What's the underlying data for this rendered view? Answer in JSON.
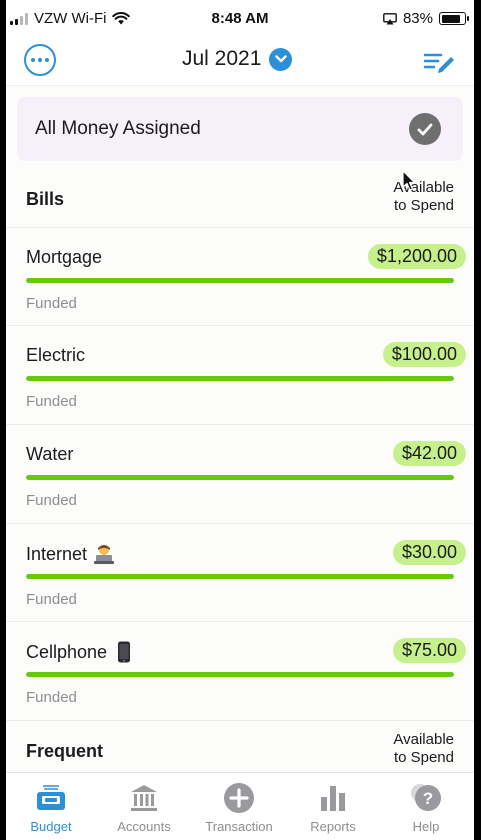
{
  "status_bar": {
    "carrier": "VZW Wi-Fi",
    "time": "8:48 AM",
    "battery_percent": "83%",
    "battery_level": 0.83
  },
  "header": {
    "month": "Jul 2021",
    "more_icon": "ellipsis-circle-icon",
    "month_icon": "chevron-down-circle-icon",
    "edit_icon": "edit-list-icon"
  },
  "assigned_banner": {
    "label": "All Money Assigned",
    "icon": "check-circle-icon"
  },
  "groups": [
    {
      "title": "Bills",
      "available_label": [
        "Available",
        "to Spend"
      ]
    },
    {
      "title": "Frequent",
      "available_label": [
        "Available",
        "to Spend"
      ]
    }
  ],
  "categories": [
    {
      "name": "Mortgage",
      "emoji": "",
      "amount": "$1,200.00",
      "status": "Funded",
      "progress": 1.0
    },
    {
      "name": "Electric",
      "emoji": "",
      "amount": "$100.00",
      "status": "Funded",
      "progress": 1.0
    },
    {
      "name": "Water",
      "emoji": "",
      "amount": "$42.00",
      "status": "Funded",
      "progress": 1.0
    },
    {
      "name": "Internet",
      "emoji": "technologist-emoji",
      "amount": "$30.00",
      "status": "Funded",
      "progress": 1.0
    },
    {
      "name": "Cellphone",
      "emoji": "mobile-phone-emoji",
      "amount": "$75.00",
      "status": "Funded",
      "progress": 1.0
    }
  ],
  "tab_bar": [
    {
      "label": "Budget",
      "icon": "budget-icon",
      "active": true
    },
    {
      "label": "Accounts",
      "icon": "bank-icon",
      "active": false
    },
    {
      "label": "Transaction",
      "icon": "plus-circle-icon",
      "active": false
    },
    {
      "label": "Reports",
      "icon": "bar-chart-icon",
      "active": false
    },
    {
      "label": "Help",
      "icon": "help-bubble-icon",
      "active": false
    }
  ],
  "colors": {
    "accent": "#2d8fd5",
    "funded_pill": "#c6f08c",
    "progress_fill": "#67c80e",
    "banner_bg": "#f6f0fb"
  }
}
